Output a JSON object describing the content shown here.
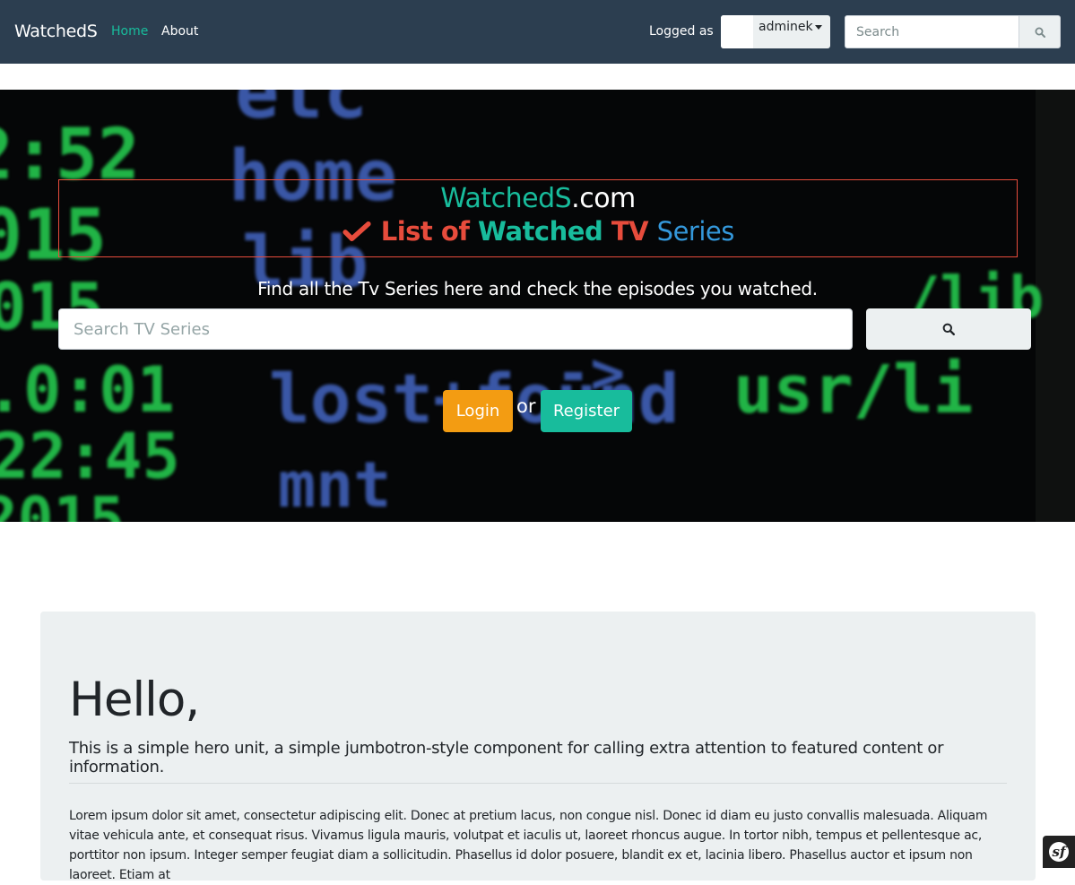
{
  "navbar": {
    "brand": "WatchedS",
    "links": [
      {
        "label": "Home",
        "active": true
      },
      {
        "label": "About",
        "active": false
      }
    ],
    "logged_as_label": "Logged as",
    "user_dropdown": {
      "username": "adminek"
    },
    "search": {
      "placeholder": "Search",
      "value": "",
      "button_icon": "search-icon"
    }
  },
  "hero": {
    "background_words": {
      "green": [
        "2:52",
        "015",
        "015",
        ".0:01",
        "22:45",
        "2015",
        "usr/li",
        "/lib"
      ],
      "blue": [
        "etc",
        "home",
        "lib",
        "lost+found",
        "mnt",
        "->"
      ]
    },
    "title": {
      "site_name_part1": "WatchedS",
      "site_name_part2": ".com",
      "tagline_part1": "List of",
      "tagline_part2": "Watched",
      "tagline_part3": "TV",
      "tagline_part4": "Series",
      "check_icon": "check-icon"
    },
    "lead": "Find all the Tv Series here and check the episodes you watched.",
    "search": {
      "placeholder": "Search TV Series",
      "value": "",
      "button_icon": "search-icon"
    },
    "login_label": "Login",
    "or_label": "or",
    "register_label": "Register"
  },
  "jumbotron": {
    "heading": "Hello,",
    "lead": "This is a simple hero unit, a simple jumbotron-style component for calling extra attention to featured content or information.",
    "body": "Lorem ipsum dolor sit amet, consectetur adipiscing elit. Donec at pretium lacus, non congue nisl. Donec id diam eu justo convallis malesuada. Aliquam vitae vehicula ante, et consequat risus. Vivamus ligula mauris, volutpat et iaculis ut, laoreet rhoncus augue. In tortor nibh, tempus et pellentesque ac, porttitor non ipsum. Integer semper feugiat diam a sollicitudin. Phasellus id dolor posuere, blandit ex et, lacinia libero. Phasellus auctor et ipsum non laoreet. Etiam at"
  },
  "debug_toolbar": {
    "icon": "symfony-icon",
    "glyph": "sf"
  },
  "colors": {
    "navbar_bg": "#2c3e50",
    "accent_teal": "#18bc9c",
    "accent_red": "#e74c3c",
    "accent_blue": "#3498db",
    "warning_orange": "#f39c12",
    "jumbotron_bg": "#ecf0f1"
  }
}
